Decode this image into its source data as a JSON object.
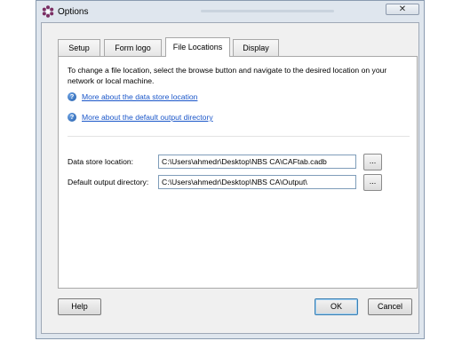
{
  "window": {
    "title": "Options",
    "close_glyph": "✕"
  },
  "tabs": [
    {
      "label": "Setup",
      "active": false
    },
    {
      "label": "Form logo",
      "active": false
    },
    {
      "label": "File Locations",
      "active": true
    },
    {
      "label": "Display",
      "active": false
    }
  ],
  "file_locations": {
    "intro": "To change a file location, select the browse button and navigate to the desired location on your network or local machine.",
    "links": [
      {
        "text": "More about the data store location",
        "icon": "help-icon"
      },
      {
        "text": "More about the default output directory",
        "icon": "help-icon"
      }
    ],
    "data_store": {
      "label": "Data store location:",
      "value": "C:\\Users\\ahmedr\\Desktop\\NBS CA\\CAFtab.cadb",
      "browse_label": "..."
    },
    "output_dir": {
      "label": "Default output directory:",
      "value": "C:\\Users\\ahmedr\\Desktop\\NBS CA\\Output\\",
      "browse_label": "..."
    }
  },
  "footer": {
    "help_label": "Help",
    "ok_label": "OK",
    "cancel_label": "Cancel"
  },
  "colors": {
    "link": "#1a56c9",
    "window_frame": "#dfe6ee",
    "dialog_bg": "#f0f0f0",
    "app_icon": "#7b2e63"
  }
}
